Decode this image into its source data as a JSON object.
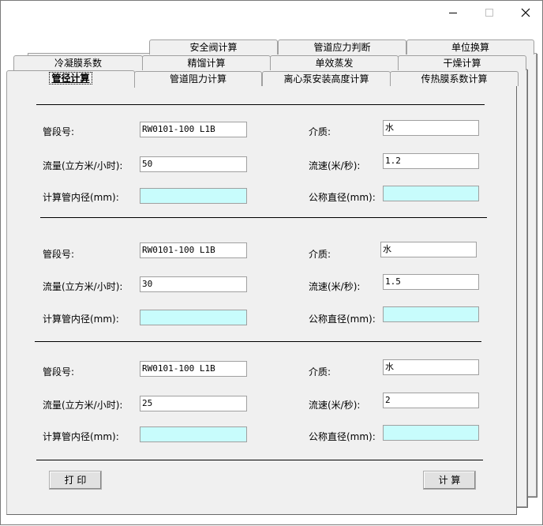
{
  "window": {
    "minimize_icon": "minimize-icon",
    "maximize_icon": "maximize-icon",
    "close_icon": "close-icon"
  },
  "tabs": {
    "row1": [
      "安全阀计算",
      "管道应力判断",
      "单位换算"
    ],
    "row2": [
      "冷凝膜系数",
      "精馏计算",
      "单效蒸发",
      "干燥计算"
    ],
    "row3": [
      "管径计算",
      "管道阻力计算",
      "离心泵安装高度计算",
      "传热膜系数计算"
    ]
  },
  "labels": {
    "segment": "管段号:",
    "flow": "流量(立方米/小时):",
    "inner_diameter": "计算管内径(mm):",
    "medium": "介质:",
    "velocity": "流速(米/秒):",
    "nominal_diameter": "公称直径(mm):"
  },
  "groups": [
    {
      "segment": "RW0101-100 L1B",
      "flow": "50",
      "inner_diameter": "",
      "medium": "水",
      "velocity": "1.2",
      "nominal_diameter": ""
    },
    {
      "segment": "RW0101-100 L1B",
      "flow": "30",
      "inner_diameter": "",
      "medium": "水",
      "velocity": "1.5",
      "nominal_diameter": ""
    },
    {
      "segment": "RW0101-100 L1B",
      "flow": "25",
      "inner_diameter": "",
      "medium": "水",
      "velocity": "2",
      "nominal_diameter": ""
    }
  ],
  "buttons": {
    "print": "打 印",
    "calculate": "计 算"
  },
  "colors": {
    "result_field": "#c8fcfc",
    "panel": "#f0f0f0"
  }
}
